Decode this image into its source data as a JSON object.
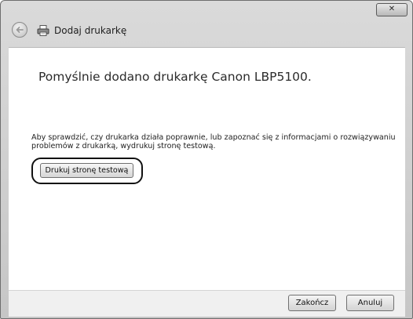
{
  "window": {
    "title": "Dodaj drukarkę",
    "close_label": "✕"
  },
  "main": {
    "heading": "Pomyślnie dodano drukarkę Canon LBP5100.",
    "description": "Aby sprawdzić, czy drukarka działa poprawnie, lub zapoznać się z informacjami o rozwiązywaniu problemów z drukarką, wydrukuj stronę testową.",
    "print_test_label": "Drukuj stronę testową"
  },
  "footer": {
    "finish_label": "Zakończ",
    "cancel_label": "Anuluj"
  },
  "icons": {
    "back": "back-arrow-icon",
    "printer": "printer-icon",
    "close": "close-icon"
  }
}
